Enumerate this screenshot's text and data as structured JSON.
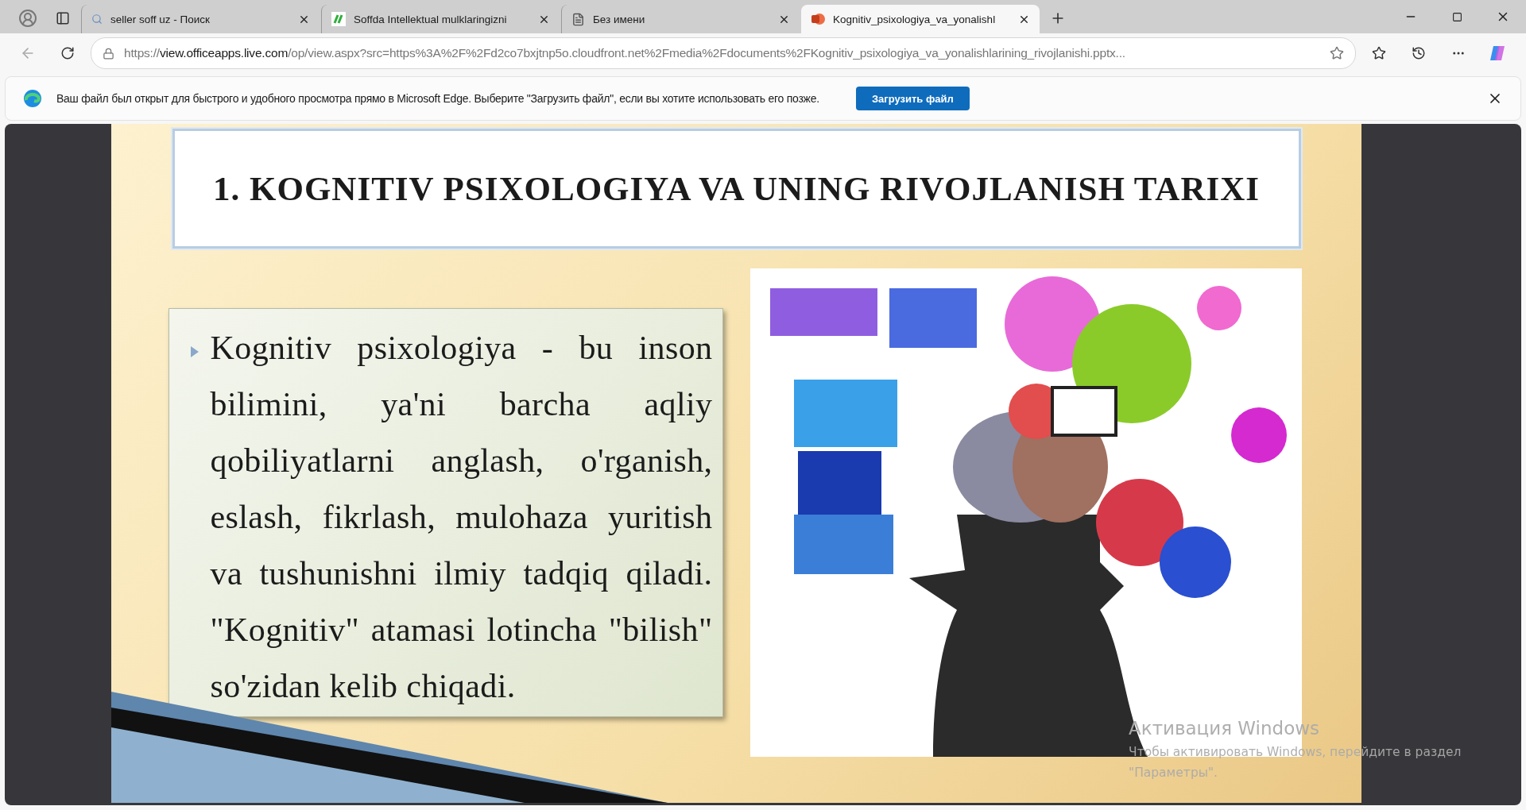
{
  "tabs": [
    {
      "title": "seller soff uz - Поиск",
      "selected": false
    },
    {
      "title": "Soffda Intellektual mulklaringizni",
      "selected": false
    },
    {
      "title": "Без имени",
      "selected": false
    },
    {
      "title": "Kognitiv_psixologiya_va_yonalishl",
      "selected": true
    }
  ],
  "address_bar": {
    "host_prefix": "https://",
    "host": "view.officeapps.live.com",
    "path": "/op/view.aspx?src=https%3A%2F%2Fd2co7bxjtnp5o.cloudfront.net%2Fmedia%2Fdocuments%2FKognitiv_psixologiya_va_yonalishlarining_rivojlanishi.pptx..."
  },
  "info_bar": {
    "message": "Ваш файл был открыт для быстрого и удобного просмотра прямо в Microsoft Edge. Выберите \"Загрузить файл\", если вы хотите использовать его позже.",
    "button": "Загрузить файл"
  },
  "slide": {
    "title": "1. KOGNITIV PSIXOLOGIYA VA UNING RIVOJLANISH TARIXI",
    "bullet": "Kognitiv psixologiya - bu inson bilimini, ya'ni barcha aqliy qobiliyatlarni anglash, o'rganish, eslash, fikrlash, mulohaza yuritish va tushunishni ilmiy tadqiq qiladi. \"Kognitiv\" atamasi lotincha \"bilish\" so'zidan kelib chiqadi."
  },
  "activation_notice": {
    "title": "Активация Windows",
    "text": "Чтобы активировать Windows, перейдите в раздел \"Параметры\"."
  }
}
